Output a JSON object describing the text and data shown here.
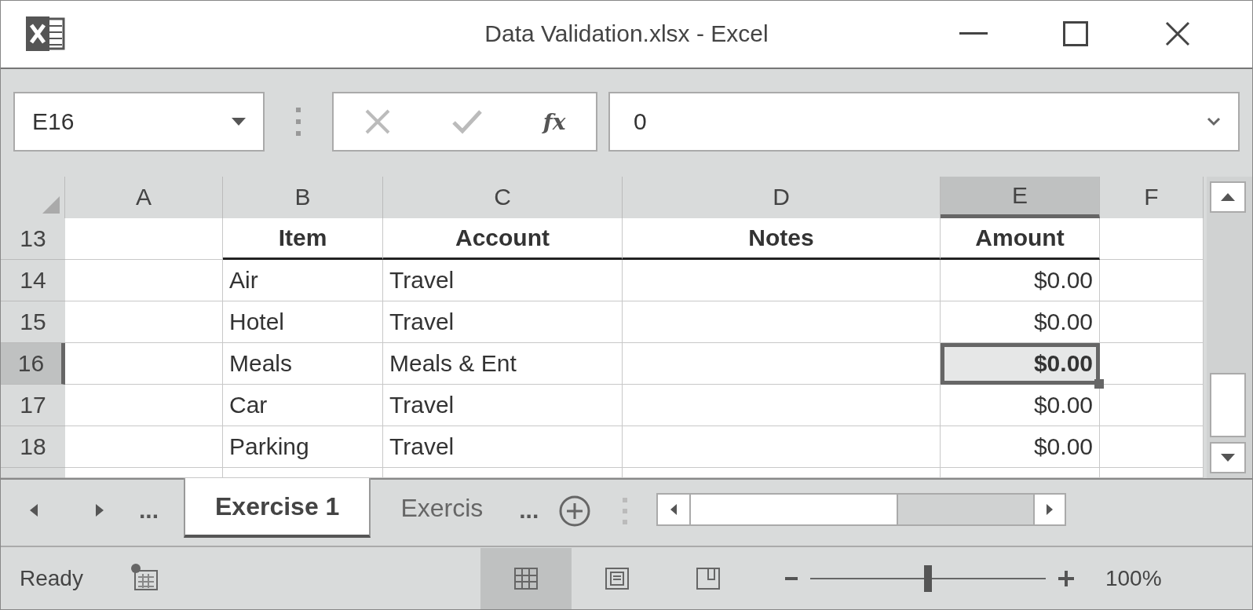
{
  "window": {
    "title": "Data Validation.xlsx - Excel"
  },
  "formula_bar": {
    "name_box": "E16",
    "function_button": "fx",
    "value": "0"
  },
  "columns": [
    {
      "label": "A",
      "selected": false,
      "kind": "text"
    },
    {
      "label": "B",
      "selected": false,
      "kind": "text"
    },
    {
      "label": "C",
      "selected": false,
      "kind": "text"
    },
    {
      "label": "D",
      "selected": false,
      "kind": "text"
    },
    {
      "label": "E",
      "selected": true,
      "kind": "currency"
    },
    {
      "label": "F",
      "selected": false,
      "kind": "text"
    }
  ],
  "rows": [
    {
      "number": "13",
      "kind": "header",
      "selected": false,
      "cells": [
        "",
        "Item",
        "Account",
        "Notes",
        "Amount",
        ""
      ]
    },
    {
      "number": "14",
      "kind": "data",
      "selected": false,
      "cells": [
        "",
        "Air",
        "Travel",
        "",
        "$0.00",
        ""
      ]
    },
    {
      "number": "15",
      "kind": "data",
      "selected": false,
      "cells": [
        "",
        "Hotel",
        "Travel",
        "",
        "$0.00",
        ""
      ]
    },
    {
      "number": "16",
      "kind": "data",
      "selected": true,
      "cells": [
        "",
        "Meals",
        "Meals & Ent",
        "",
        "$0.00",
        ""
      ]
    },
    {
      "number": "17",
      "kind": "data",
      "selected": false,
      "cells": [
        "",
        "Car",
        "Travel",
        "",
        "$0.00",
        ""
      ]
    },
    {
      "number": "18",
      "kind": "data",
      "selected": false,
      "cells": [
        "",
        "Parking",
        "Travel",
        "",
        "$0.00",
        ""
      ]
    }
  ],
  "sheet_tabs": {
    "more_left": "...",
    "tabs": [
      {
        "label": "Exercise 1",
        "selected": true
      },
      {
        "label": "Exercis",
        "selected": false
      }
    ],
    "more_right": "..."
  },
  "status_bar": {
    "status": "Ready",
    "views": [
      {
        "kind": "normal",
        "selected": true
      },
      {
        "kind": "page_layout",
        "selected": false
      },
      {
        "kind": "page_break",
        "selected": false
      }
    ],
    "zoom": {
      "level": 0.5,
      "label": "100%"
    }
  }
}
